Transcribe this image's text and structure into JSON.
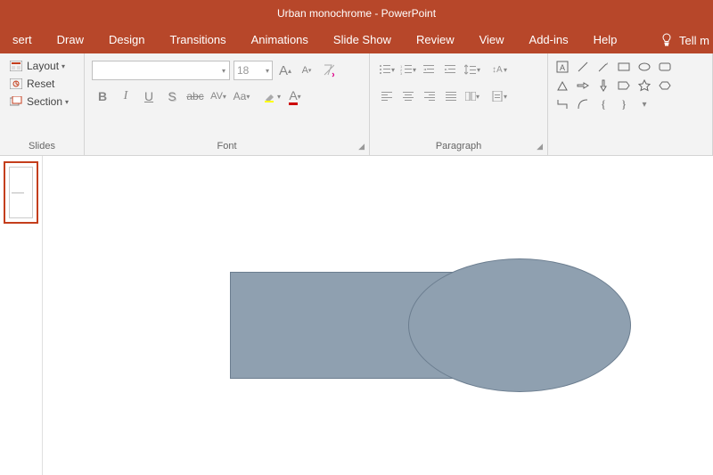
{
  "title": "Urban monochrome  -  PowerPoint",
  "tabs": [
    "sert",
    "Draw",
    "Design",
    "Transitions",
    "Animations",
    "Slide Show",
    "Review",
    "View",
    "Add-ins",
    "Help"
  ],
  "tellme": "Tell m",
  "slides": {
    "layout": "Layout",
    "reset": "Reset",
    "section": "Section",
    "label": "Slides"
  },
  "font": {
    "name_placeholder": "",
    "size": "18",
    "label": "Font"
  },
  "paragraph": {
    "label": "Paragraph"
  },
  "canvas": {
    "shape_fill": "#8fa0b0",
    "shape_stroke": "#6b7d8f"
  }
}
